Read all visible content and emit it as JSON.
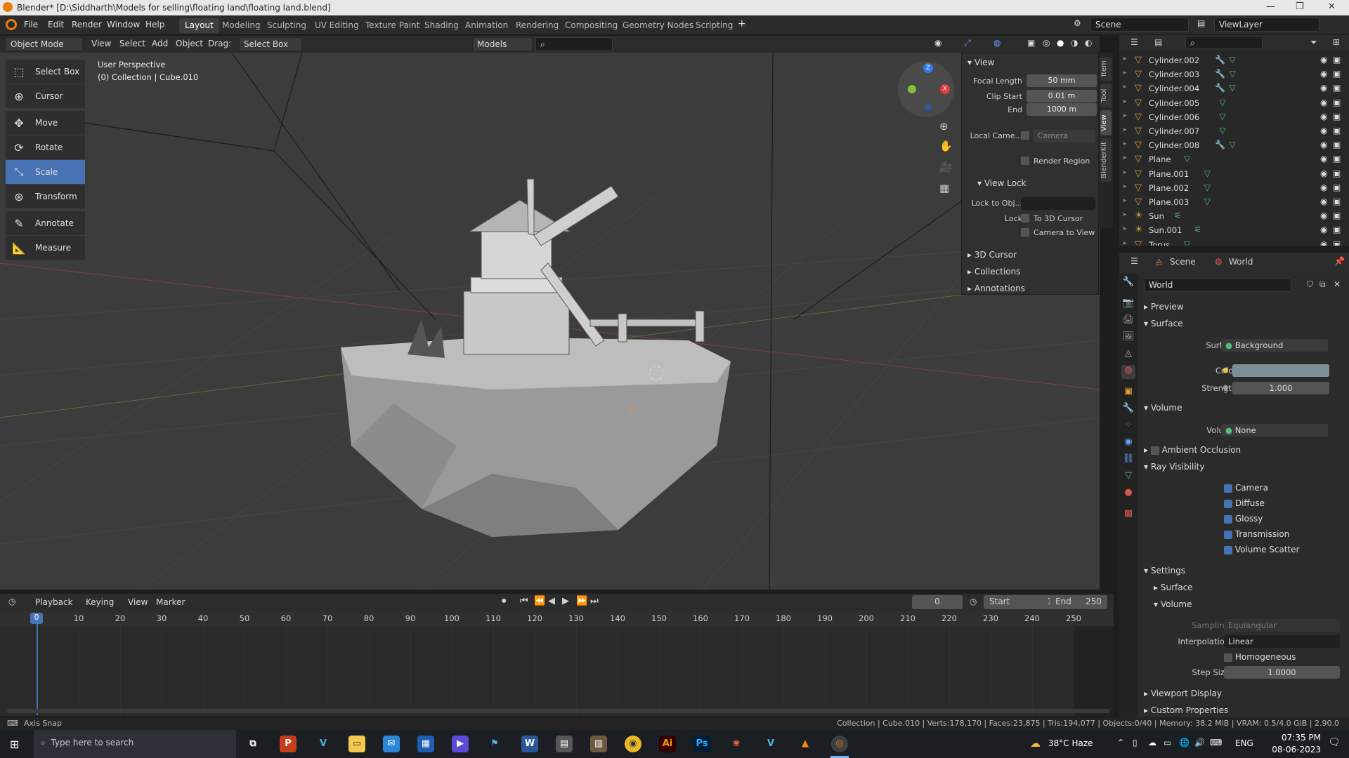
{
  "window": {
    "title": "Blender* [D:\\Siddharth\\Models for selling\\floating land\\floating land.blend]",
    "minimize_icon": "minimize-icon",
    "maximize_icon": "restore-icon",
    "close_icon": "close-icon"
  },
  "menubar": {
    "items": [
      "File",
      "Edit",
      "Render",
      "Window",
      "Help"
    ],
    "workspaces": [
      "Layout",
      "Modeling",
      "Sculpting",
      "UV Editing",
      "Texture Paint",
      "Shading",
      "Animation",
      "Rendering",
      "Compositing",
      "Geometry Nodes",
      "Scripting"
    ],
    "active_workspace": "Layout",
    "scene": "Scene",
    "view_layer": "ViewLayer"
  },
  "viewport_header": {
    "mode": "Object Mode",
    "menus": [
      "View",
      "Select",
      "Add",
      "Object"
    ],
    "drag_label": "Drag:",
    "drag_value": "Select Box",
    "orientation": "Models"
  },
  "viewport": {
    "perspective": "User Perspective",
    "collection": "(0) Collection | Cube.010"
  },
  "toolbox": [
    {
      "label": "Select Box",
      "icon": "select-box-icon"
    },
    {
      "label": "Cursor",
      "icon": "cursor-icon"
    },
    {
      "label": "Move",
      "icon": "move-icon"
    },
    {
      "label": "Rotate",
      "icon": "rotate-icon"
    },
    {
      "label": "Scale",
      "icon": "scale-icon",
      "active": true
    },
    {
      "label": "Transform",
      "icon": "transform-icon"
    },
    {
      "label": "Annotate",
      "icon": "annotate-icon"
    },
    {
      "label": "Measure",
      "icon": "measure-icon"
    }
  ],
  "npanel": {
    "view_title": "View",
    "focal_length_label": "Focal Length",
    "focal_length": "50 mm",
    "clip_start_label": "Clip Start",
    "clip_start": "0.01 m",
    "end_label": "End",
    "end": "1000 m",
    "local_camera_label": "Local Came...",
    "local_camera_value": "Camera",
    "render_region": "Render Region",
    "view_lock_title": "View Lock",
    "lock_to_obj_label": "Lock to Obj...",
    "lock_label": "Lock",
    "to_3d_cursor": "To 3D Cursor",
    "camera_to_view": "Camera to View",
    "sections": [
      "3D Cursor",
      "Collections",
      "Annotations"
    ],
    "tabs": [
      "Item",
      "Tool",
      "View",
      "BlenderKit"
    ]
  },
  "outliner": {
    "rows": [
      {
        "name": "Cylinder.002",
        "modifier": true
      },
      {
        "name": "Cylinder.003",
        "modifier": true
      },
      {
        "name": "Cylinder.004",
        "modifier": true
      },
      {
        "name": "Cylinder.005",
        "modifier": false
      },
      {
        "name": "Cylinder.006",
        "modifier": false
      },
      {
        "name": "Cylinder.007",
        "modifier": false
      },
      {
        "name": "Cylinder.008",
        "modifier": true
      },
      {
        "name": "Plane",
        "modifier": false
      },
      {
        "name": "Plane.001",
        "modifier": false
      },
      {
        "name": "Plane.002",
        "modifier": false
      },
      {
        "name": "Plane.003",
        "modifier": false
      },
      {
        "name": "Sun",
        "modifier": false,
        "light": true
      },
      {
        "name": "Sun.001",
        "modifier": false,
        "light": true
      },
      {
        "name": "Torus",
        "modifier": false
      }
    ]
  },
  "properties": {
    "breadcrumb_scene": "Scene",
    "breadcrumb_world": "World",
    "world_name": "World",
    "preview": "Preview",
    "surface_title": "Surface",
    "surface_label": "Surface",
    "surface_value": "Background",
    "color_label": "Color",
    "color_value": "#7b8f96",
    "strength_label": "Strength",
    "strength_value": "1.000",
    "volume_title": "Volume",
    "volume_label": "Volume",
    "volume_value": "None",
    "ambient_occlusion": "Ambient Occlusion",
    "ray_visibility": "Ray Visibility",
    "ray_items": [
      "Camera",
      "Diffuse",
      "Glossy",
      "Transmission",
      "Volume Scatter"
    ],
    "settings": "Settings",
    "settings_surface": "Surface",
    "settings_volume": "Volume",
    "sampling_label": "Sampling",
    "sampling_value": "Equiangular",
    "interpolation_label": "Interpolation",
    "interpolation_value": "Linear",
    "homogeneous": "Homogeneous",
    "step_size_label": "Step Size",
    "step_size_value": "1.0000",
    "viewport_display": "Viewport Display",
    "custom_properties": "Custom Properties"
  },
  "timeline": {
    "menus": [
      "Playback",
      "Keying",
      "View",
      "Marker"
    ],
    "current_frame": "0",
    "start_label": "Start",
    "start": "1",
    "end_label": "End",
    "end": "250",
    "ticks": [
      "0",
      "10",
      "20",
      "30",
      "40",
      "50",
      "60",
      "70",
      "80",
      "90",
      "100",
      "110",
      "120",
      "130",
      "140",
      "150",
      "160",
      "170",
      "180",
      "190",
      "200",
      "210",
      "220",
      "230",
      "240",
      "250"
    ]
  },
  "statusbar": {
    "left": "Axis Snap",
    "right": "Collection | Cube.010 | Verts:178,170 | Faces:23,875 | Tris:194,077 | Objects:0/40 | Memory: 38.2 MiB | VRAM: 0.5/4.0 GiB | 2.90.0"
  },
  "taskbar": {
    "search_placeholder": "Type here to search",
    "weather": "38°C  Haze",
    "lang": "ENG",
    "time": "07:35 PM",
    "date": "08-06-2023"
  },
  "colors": {
    "accent": "#4772b3",
    "object_orange": "#e39b3b",
    "mesh_green": "#4fbf7a",
    "modifier_blue": "#60a0ff"
  }
}
